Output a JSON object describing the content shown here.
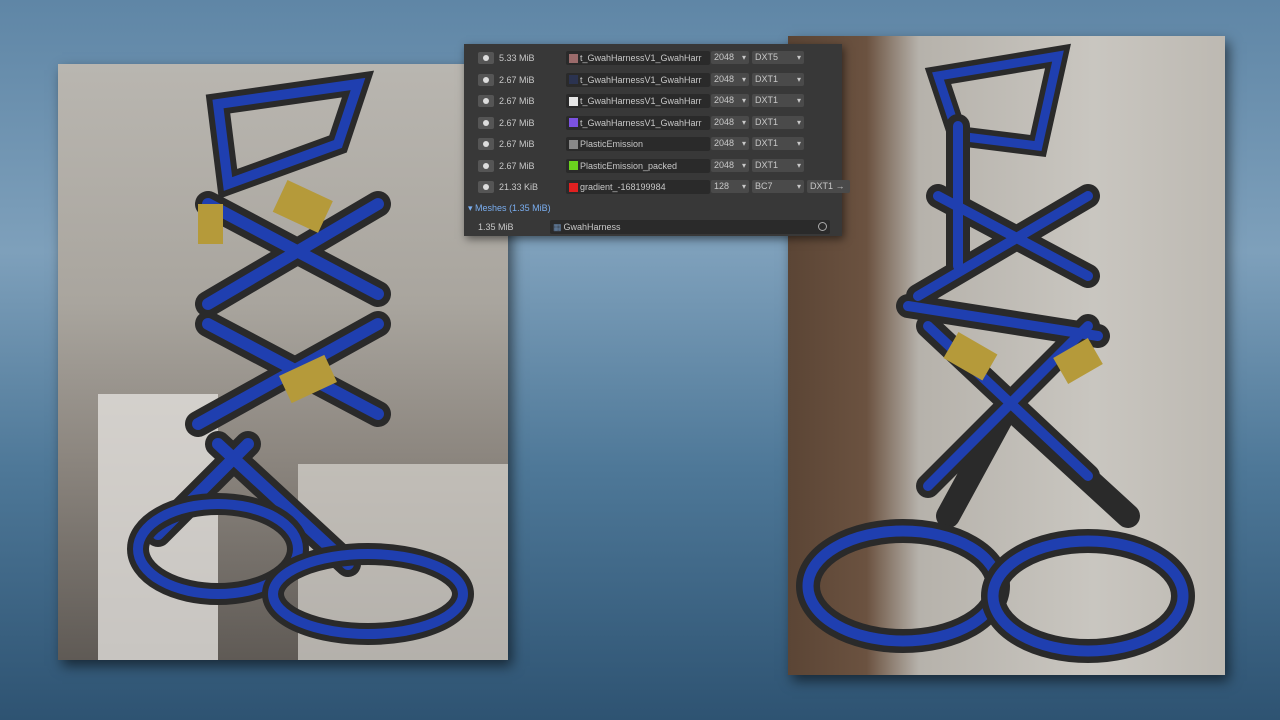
{
  "textures": [
    {
      "size": "5.33 MiB",
      "name": "t_GwahHarnessV1_GwahHarr",
      "swatch": "#9b6b6b",
      "resolution": "2048",
      "format": "DXT5"
    },
    {
      "size": "2.67 MiB",
      "name": "t_GwahHarnessV1_GwahHarr",
      "swatch": "#2b3350",
      "resolution": "2048",
      "format": "DXT1"
    },
    {
      "size": "2.67 MiB",
      "name": "t_GwahHarnessV1_GwahHarr",
      "swatch": "#e6e6e6",
      "resolution": "2048",
      "format": "DXT1"
    },
    {
      "size": "2.67 MiB",
      "name": "t_GwahHarnessV1_GwahHarr",
      "swatch": "#7b52e0",
      "resolution": "2048",
      "format": "DXT1"
    },
    {
      "size": "2.67 MiB",
      "name": "PlasticEmission",
      "swatch": "#888888",
      "resolution": "2048",
      "format": "DXT1"
    },
    {
      "size": "2.67 MiB",
      "name": "PlasticEmission_packed",
      "swatch": "#6ad11e",
      "resolution": "2048",
      "format": "DXT1"
    },
    {
      "size": "21.33 KiB",
      "name": "gradient_-168199984",
      "swatch": "#e02020",
      "resolution": "128",
      "format": "BC7",
      "extra": "DXT1 →"
    }
  ],
  "meshes": {
    "header": "Meshes",
    "total": "(1.35 MiB)",
    "items": [
      {
        "size": "1.35 MiB",
        "name": "GwahHarness"
      }
    ]
  },
  "colors": {
    "harness_blue": "#1f3fb0",
    "strap_black": "#2a2a2a",
    "buckle_gold": "#b59a3a"
  }
}
